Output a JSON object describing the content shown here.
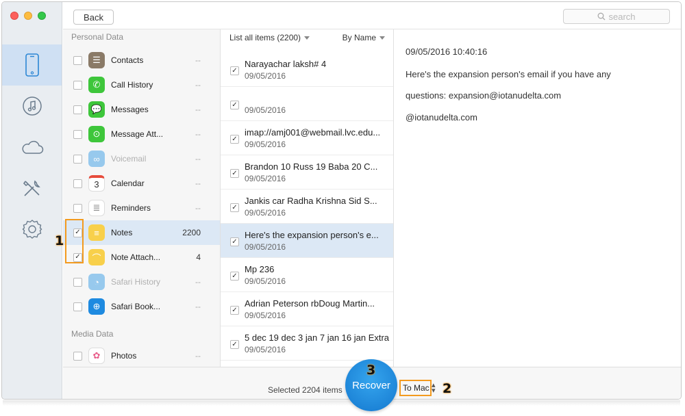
{
  "header": {
    "back_label": "Back",
    "search_placeholder": "search"
  },
  "rail": [
    {
      "name": "device-icon",
      "active": true
    },
    {
      "name": "music-icon",
      "active": false
    },
    {
      "name": "icloud-icon",
      "active": false
    },
    {
      "name": "tools-icon",
      "active": false
    },
    {
      "name": "settings-icon",
      "active": false
    }
  ],
  "categories": {
    "personal_label": "Personal Data",
    "media_label": "Media Data",
    "items": [
      {
        "label": "Contacts",
        "count": "--",
        "icon": "contacts-icon",
        "checked": false,
        "dim": false
      },
      {
        "label": "Call History",
        "count": "--",
        "icon": "phone-icon",
        "checked": false,
        "dim": false
      },
      {
        "label": "Messages",
        "count": "--",
        "icon": "messages-icon",
        "checked": false,
        "dim": false
      },
      {
        "label": "Message Att...",
        "count": "--",
        "icon": "message-attachment-icon",
        "checked": false,
        "dim": false
      },
      {
        "label": "Voicemail",
        "count": "--",
        "icon": "voicemail-icon",
        "checked": false,
        "dim": true
      },
      {
        "label": "Calendar",
        "count": "--",
        "icon": "calendar-icon",
        "checked": false,
        "dim": false
      },
      {
        "label": "Reminders",
        "count": "--",
        "icon": "reminders-icon",
        "checked": false,
        "dim": false
      },
      {
        "label": "Notes",
        "count": "2200",
        "icon": "notes-icon",
        "checked": true,
        "dim": false
      },
      {
        "label": "Note Attach...",
        "count": "4",
        "icon": "note-attachment-icon",
        "checked": true,
        "dim": false
      },
      {
        "label": "Safari History",
        "count": "--",
        "icon": "safari-history-icon",
        "checked": false,
        "dim": true
      },
      {
        "label": "Safari Book...",
        "count": "--",
        "icon": "safari-bookmarks-icon",
        "checked": false,
        "dim": false
      }
    ],
    "media_items": [
      {
        "label": "Photos",
        "count": "--",
        "icon": "photos-icon",
        "checked": false
      }
    ],
    "calendar_day": "3"
  },
  "list": {
    "filter_label": "List all items (2200)",
    "sort_label": "By Name",
    "rows": [
      {
        "title": "Narayachar laksh# 4",
        "date": "09/05/2016"
      },
      {
        "title": "",
        "date": "09/05/2016"
      },
      {
        "title": "imap://amj001@webmail.lvc.edu...",
        "date": "09/05/2016"
      },
      {
        "title": "Brandon 10 Russ 19 Baba 20 C...",
        "date": "09/05/2016"
      },
      {
        "title": "Jankis car Radha Krishna Sid S...",
        "date": "09/05/2016"
      },
      {
        "title": "Here's the expansion person's e...",
        "date": "09/05/2016"
      },
      {
        "title": "Mp 236",
        "date": "09/05/2016"
      },
      {
        "title": "Adrian Peterson rbDoug Martin...",
        "date": "09/05/2016"
      },
      {
        "title": "5 dec 19 dec 3 jan 7 jan 16 jan Extra",
        "date": "09/05/2016"
      }
    ]
  },
  "detail": {
    "timestamp": "09/05/2016 10:40:16",
    "line1": "Here's the expansion person's email if you have any",
    "line2": "questions: expansion@iotanudelta.com",
    "line3": "@iotanudelta.com"
  },
  "footer": {
    "selected_text": "Selected 2204 items",
    "recover_label": "Recover",
    "destination": "To Mac"
  },
  "annotations": {
    "one": "1",
    "two": "2",
    "three": "3"
  },
  "colors": {
    "accent": "#1a86d9",
    "annotation": "#f39a1e",
    "selection": "#dce8f5"
  }
}
